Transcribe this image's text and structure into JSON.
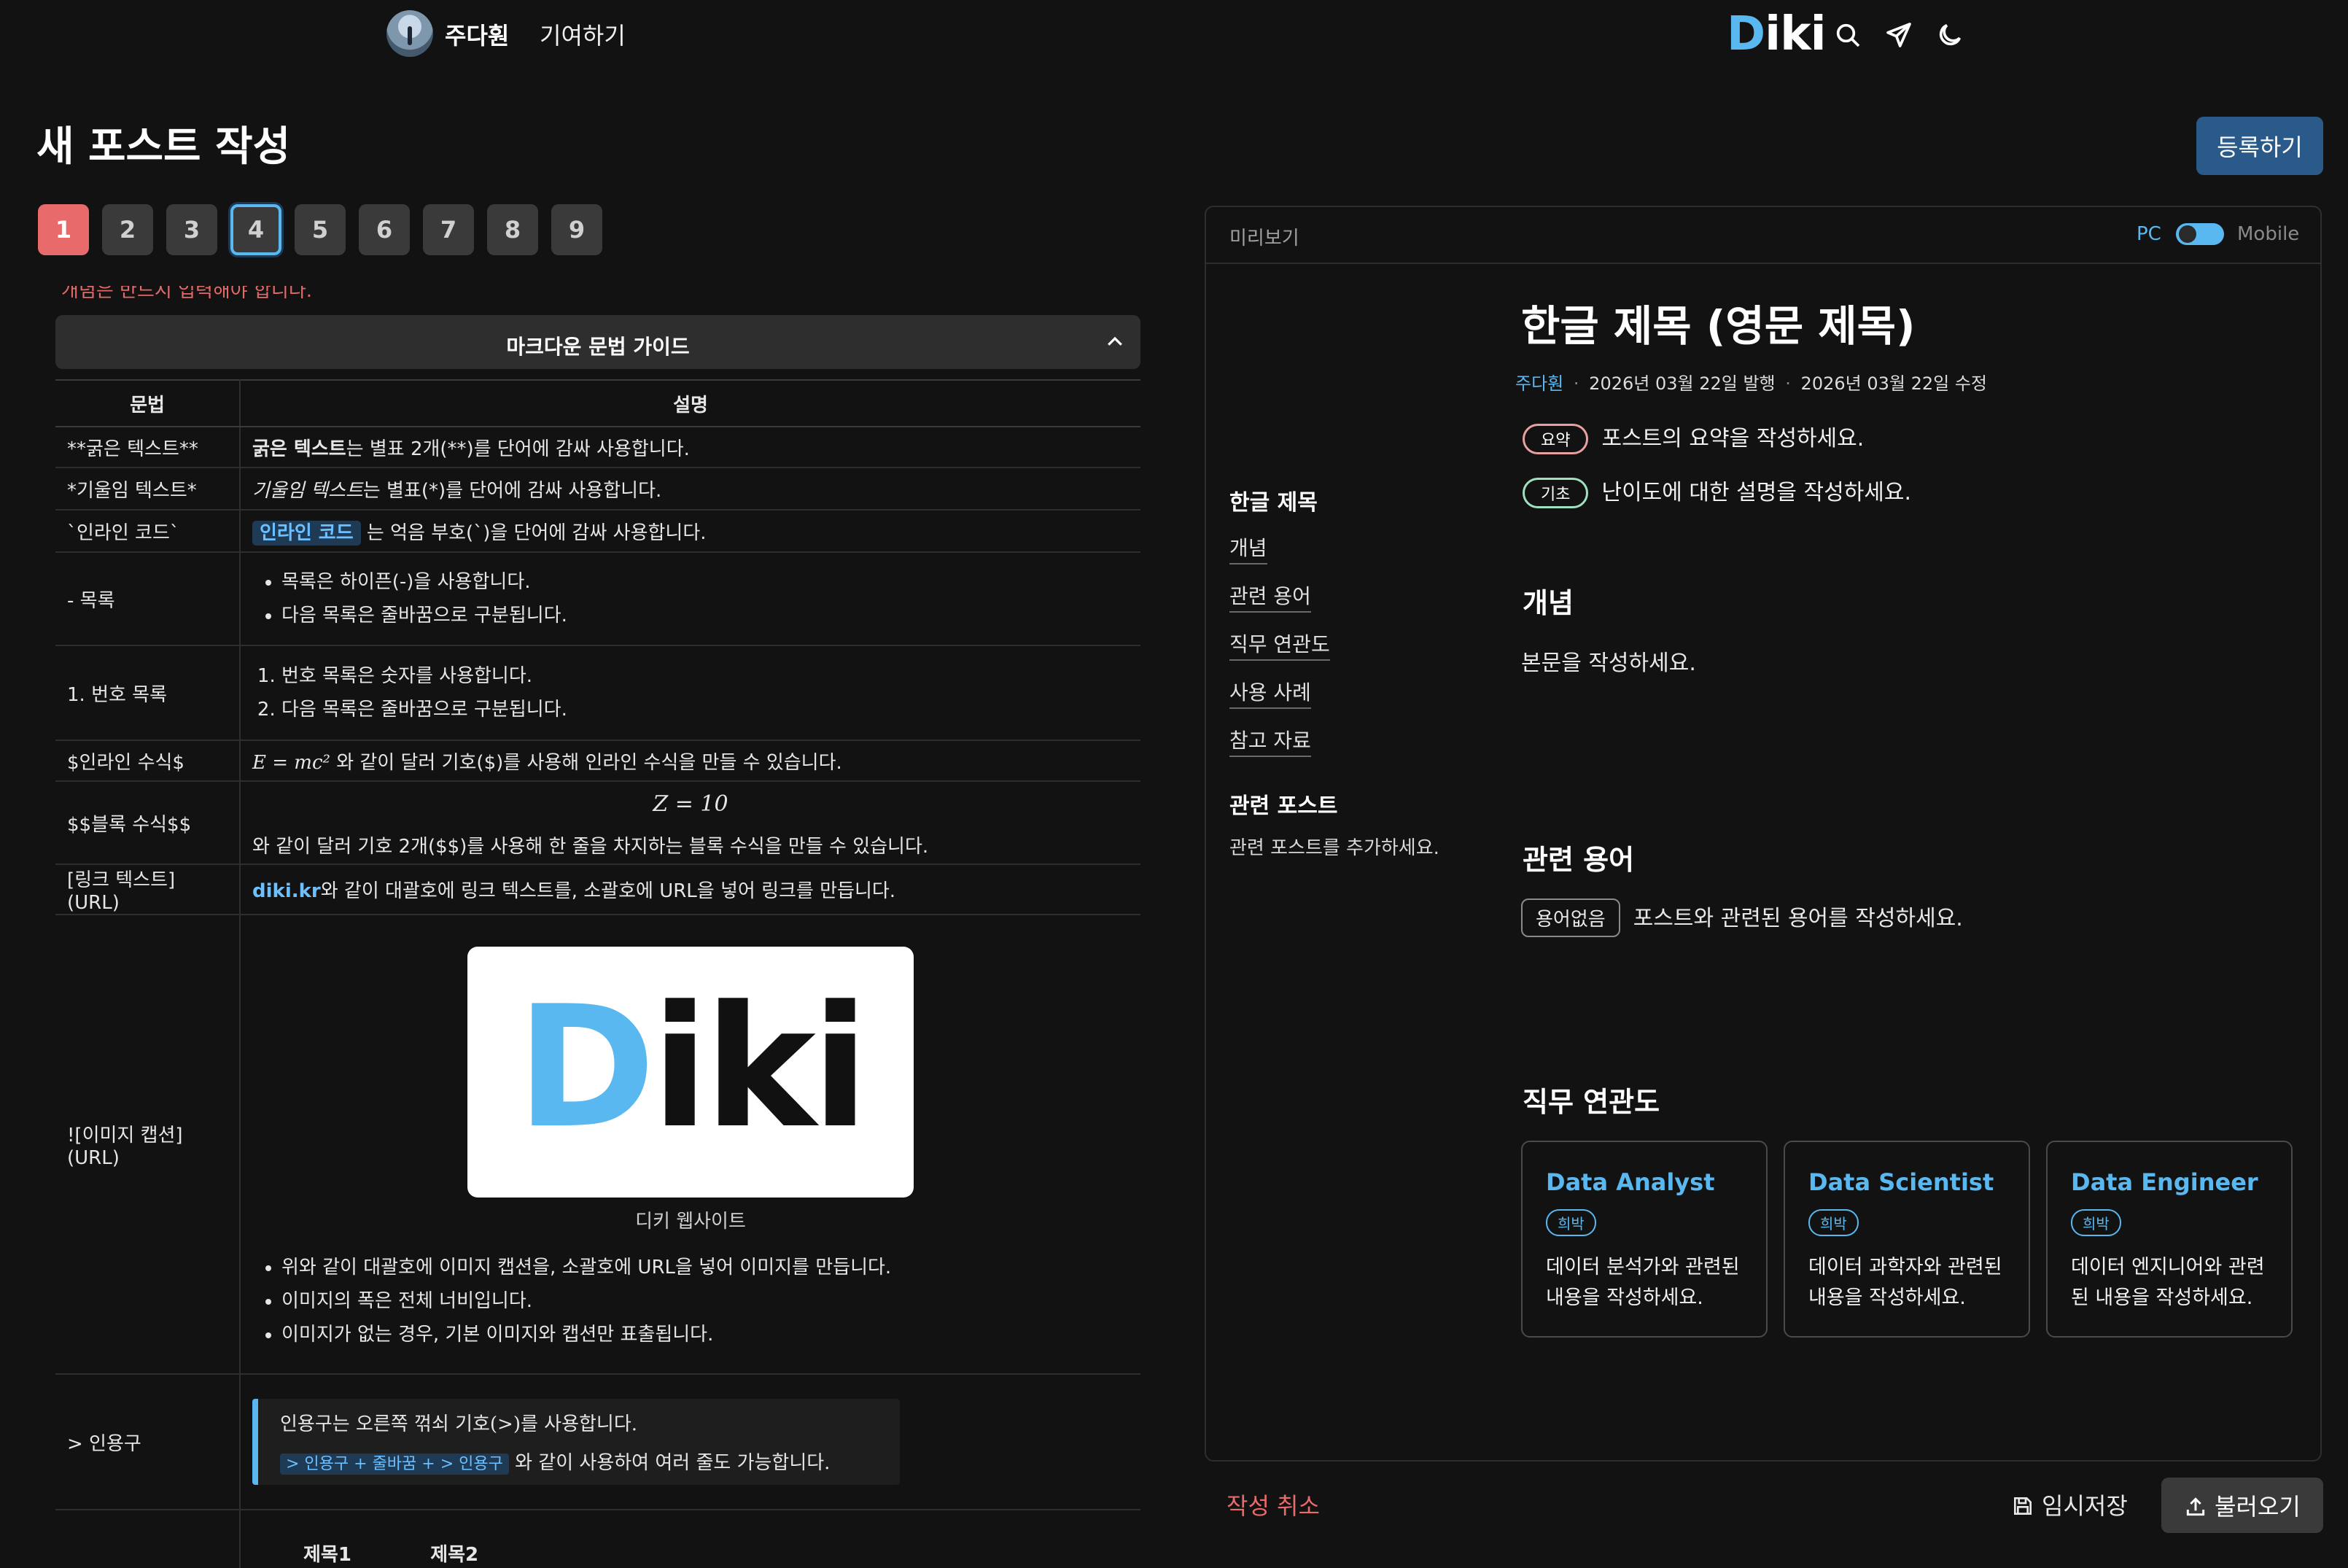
{
  "nav": {
    "user_name": "주다훤",
    "contribute": "기여하기",
    "logo_first": "D",
    "logo_rest": "iki",
    "icons": [
      "search-icon",
      "send-icon",
      "moon-icon"
    ]
  },
  "page": {
    "title": "새 포스트 작성",
    "submit": "등록하기",
    "steps": [
      "1",
      "2",
      "3",
      "4",
      "5",
      "6",
      "7",
      "8",
      "9"
    ],
    "active_step": "1",
    "focused_step": "4",
    "cutoff_text": "개념은 반드시 입력해야 합니다."
  },
  "guide": {
    "title": "마크다운 문법 가이드",
    "col_syntax": "문법",
    "col_desc": "설명",
    "bold": {
      "syntax": "**굵은 텍스트**",
      "example": "굵은 텍스트",
      "desc": "는 별표 2개(**)를 단어에 감싸 사용합니다."
    },
    "italic": {
      "syntax": "*기울임 텍스트*",
      "example": "기울임 텍스트",
      "desc": "는 별표(*)를 단어에 감싸 사용합니다."
    },
    "code": {
      "syntax": "`인라인 코드`",
      "example": "인라인 코드",
      "desc": " 는 억음 부호(`)을 단어에 감싸 사용합니다."
    },
    "list": {
      "syntax": "- 목록",
      "items": [
        "목록은 하이픈(-)을 사용합니다.",
        "다음 목록은 줄바꿈으로 구분됩니다."
      ]
    },
    "olist": {
      "syntax": "1. 번호 목록",
      "items": [
        "번호 목록은 숫자를 사용합니다.",
        "다음 목록은 줄바꿈으로 구분됩니다."
      ]
    },
    "inline_math": {
      "syntax": "$인라인 수식$",
      "formula": "E = mc²",
      "desc": " 와 같이 달러 기호($)를 사용해 인라인 수식을 만들 수 있습니다."
    },
    "block_math": {
      "syntax": "$$블록 수식$$",
      "formula": "Z = 10",
      "desc": "와 같이 달러 기호 2개($$)를 사용해 한 줄을 차지하는 블록 수식을 만들 수 있습니다."
    },
    "link": {
      "syntax": "[링크 텍스트](URL)",
      "example": "diki.kr",
      "desc": "와 같이 대괄호에 링크 텍스트를, 소괄호에 URL을 넣어 링크를 만듭니다."
    },
    "image": {
      "syntax": "![이미지 캡션](URL)",
      "logo_first": "D",
      "logo_rest": "iki",
      "caption": "디키 웹사이트",
      "items": [
        "위와 같이 대괄호에 이미지 캡션을, 소괄호에 URL을 넣어 이미지를 만듭니다.",
        "이미지의 폭은 전체 너비입니다.",
        "이미지가 없는 경우, 기본 이미지와 캡션만 표출됩니다."
      ]
    },
    "quote": {
      "syntax": "> 인용구",
      "line1": "인용구는 오른쪽 꺾쇠 기호(>)를 사용합니다.",
      "code": "> 인용구 + 줄바꿈 + > 인용구",
      "line2": " 와 같이 사용하여 여러 줄도 가능합니다."
    },
    "table_header": [
      "제목1",
      "제목2"
    ]
  },
  "preview": {
    "label": "미리보기",
    "pc": "PC",
    "mobile": "Mobile",
    "title": "한글 제목 (영문 제목)",
    "author": "주다훤",
    "published": "2026년 03월 22일 발행",
    "modified": "2026년 03월 22일 수정",
    "summary_tag": "요약",
    "summary": "포스트의 요약을 작성하세요.",
    "level_tag": "기초",
    "level": "난이도에 대한 설명을 작성하세요.",
    "toc": {
      "heading": "한글 제목",
      "items": [
        "개념",
        "관련 용어",
        "직무 연관도",
        "사용 사례",
        "참고 자료"
      ]
    },
    "related_posts": {
      "heading": "관련 포스트",
      "text": "관련 포스트를 추가하세요."
    },
    "concept": {
      "heading": "개념",
      "text": "본문을 작성하세요."
    },
    "terms": {
      "heading": "관련 용어",
      "pill": "용어없음",
      "text": "포스트와 관련된 용어를 작성하세요."
    },
    "jobs": {
      "heading": "직무 연관도",
      "cards": [
        {
          "title": "Data Analyst",
          "level": "희박",
          "desc": "데이터 분석가와 관련된 내용을 작성하세요."
        },
        {
          "title": "Data Scientist",
          "level": "희박",
          "desc": "데이터 과학자와 관련된 내용을 작성하세요."
        },
        {
          "title": "Data Engineer",
          "level": "희박",
          "desc": "데이터 엔지니어와 관련된 내용을 작성하세요."
        }
      ]
    }
  },
  "footer": {
    "cancel": "작성 취소",
    "draft": "임시저장",
    "load": "불러오기"
  },
  "colors": {
    "accent": "#5ab8f0",
    "danger": "#e86a6a",
    "primary_btn": "#2a5a8a",
    "summary_border": "#e8a0a0",
    "level_border": "#a0e0c0"
  }
}
